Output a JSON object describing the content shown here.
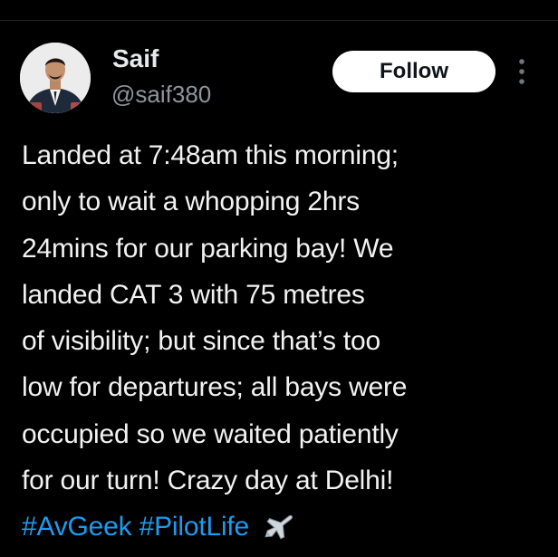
{
  "author": {
    "display_name": "Saif",
    "handle": "@saif380"
  },
  "actions": {
    "follow_label": "Follow",
    "more_icon": "more-vertical-icon"
  },
  "tweet": {
    "lines": [
      "Landed at 7:48am this morning;",
      "only to wait a whopping 2hrs",
      "24mins for our parking bay! We",
      "landed CAT 3 with 75 metres",
      "of visibility; but since that’s too",
      "low for departures; all bays were",
      "occupied so we waited patiently",
      "for our turn! Crazy day at Delhi!"
    ],
    "hashtags": [
      "#AvGeek",
      "#PilotLife"
    ],
    "emoji_icon": "airplane-icon"
  },
  "colors": {
    "background": "#000000",
    "text": "#e7e9ea",
    "secondary_text": "#8f959b",
    "link": "#1d9bf0",
    "follow_button_bg": "#ffffff",
    "follow_button_text": "#0f1419"
  }
}
